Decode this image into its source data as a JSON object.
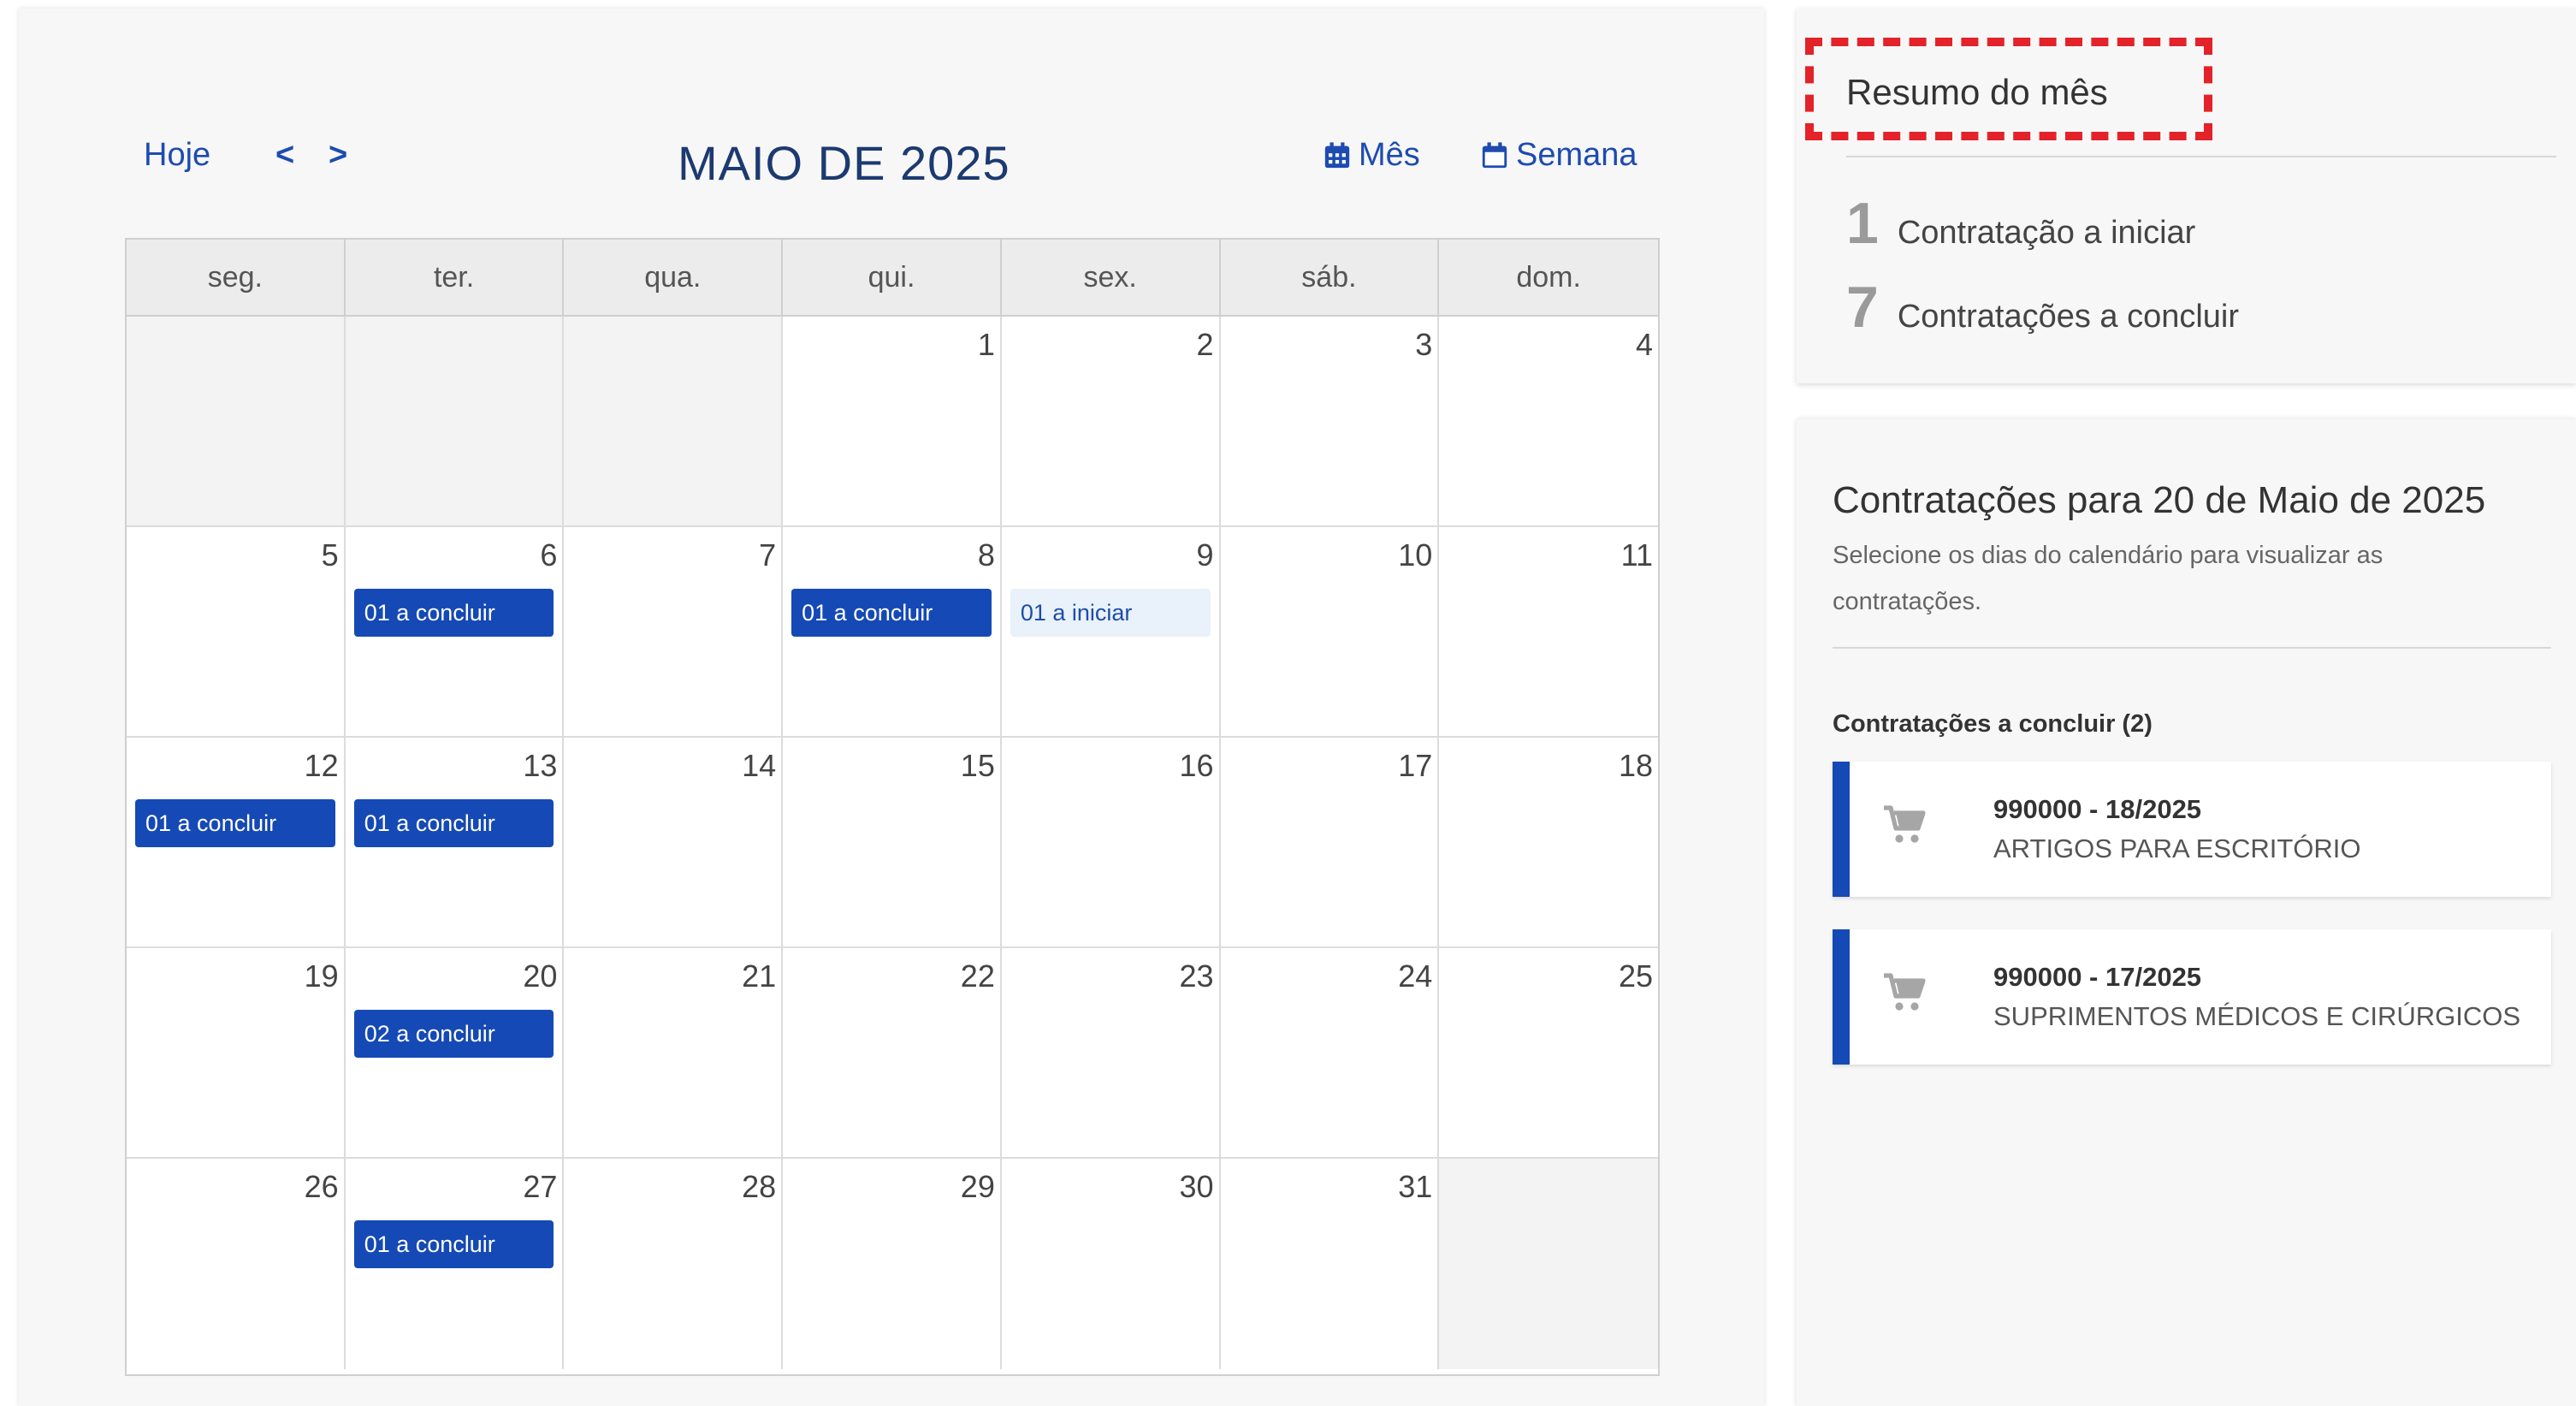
{
  "calendar": {
    "today_label": "Hoje",
    "prev_label": "<",
    "next_label": ">",
    "title": "MAIO DE 2025",
    "view_month_label": "Mês",
    "view_week_label": "Semana",
    "weekdays": [
      "seg.",
      "ter.",
      "qua.",
      "qui.",
      "sex.",
      "sáb.",
      "dom."
    ],
    "days": [
      {
        "n": ""
      },
      {
        "n": ""
      },
      {
        "n": ""
      },
      {
        "n": "1"
      },
      {
        "n": "2"
      },
      {
        "n": "3"
      },
      {
        "n": "4"
      },
      {
        "n": "5"
      },
      {
        "n": "6",
        "event": "01 a concluir",
        "kind": "conclude"
      },
      {
        "n": "7"
      },
      {
        "n": "8",
        "event": "01 a concluir",
        "kind": "conclude"
      },
      {
        "n": "9",
        "event": "01 a iniciar",
        "kind": "start"
      },
      {
        "n": "10"
      },
      {
        "n": "11"
      },
      {
        "n": "12",
        "event": "01 a concluir",
        "kind": "conclude"
      },
      {
        "n": "13",
        "event": "01 a concluir",
        "kind": "conclude"
      },
      {
        "n": "14"
      },
      {
        "n": "15"
      },
      {
        "n": "16"
      },
      {
        "n": "17"
      },
      {
        "n": "18"
      },
      {
        "n": "19"
      },
      {
        "n": "20",
        "event": "02 a concluir",
        "kind": "conclude"
      },
      {
        "n": "21"
      },
      {
        "n": "22"
      },
      {
        "n": "23"
      },
      {
        "n": "24"
      },
      {
        "n": "25"
      },
      {
        "n": "26"
      },
      {
        "n": "27",
        "event": "01 a concluir",
        "kind": "conclude"
      },
      {
        "n": "28"
      },
      {
        "n": "29"
      },
      {
        "n": "30"
      },
      {
        "n": "31"
      },
      {
        "n": ""
      }
    ]
  },
  "summary": {
    "title": "Resumo do mês",
    "rows": [
      {
        "count": "1",
        "label": "Contratação a iniciar"
      },
      {
        "count": "7",
        "label": "Contratações a concluir"
      }
    ]
  },
  "contracts": {
    "title": "Contratações para 20 de Maio de 2025",
    "description": "Selecione os dias do calendário para visualizar as contratações.",
    "subtitle": "Contratações a concluir (2)",
    "items": [
      {
        "code": "990000 - 18/2025",
        "desc": "ARTIGOS PARA ESCRITÓRIO",
        "icon": "cart-icon"
      },
      {
        "code": "990000 - 17/2025",
        "desc": "SUPRIMENTOS MÉDICOS E CIRÚRGICOS",
        "icon": "cart-icon"
      }
    ]
  },
  "colors": {
    "primary": "#1549b5",
    "link": "#1d4bb0",
    "highlight": "#e3222a",
    "event_start_bg": "#e9f2fb"
  }
}
